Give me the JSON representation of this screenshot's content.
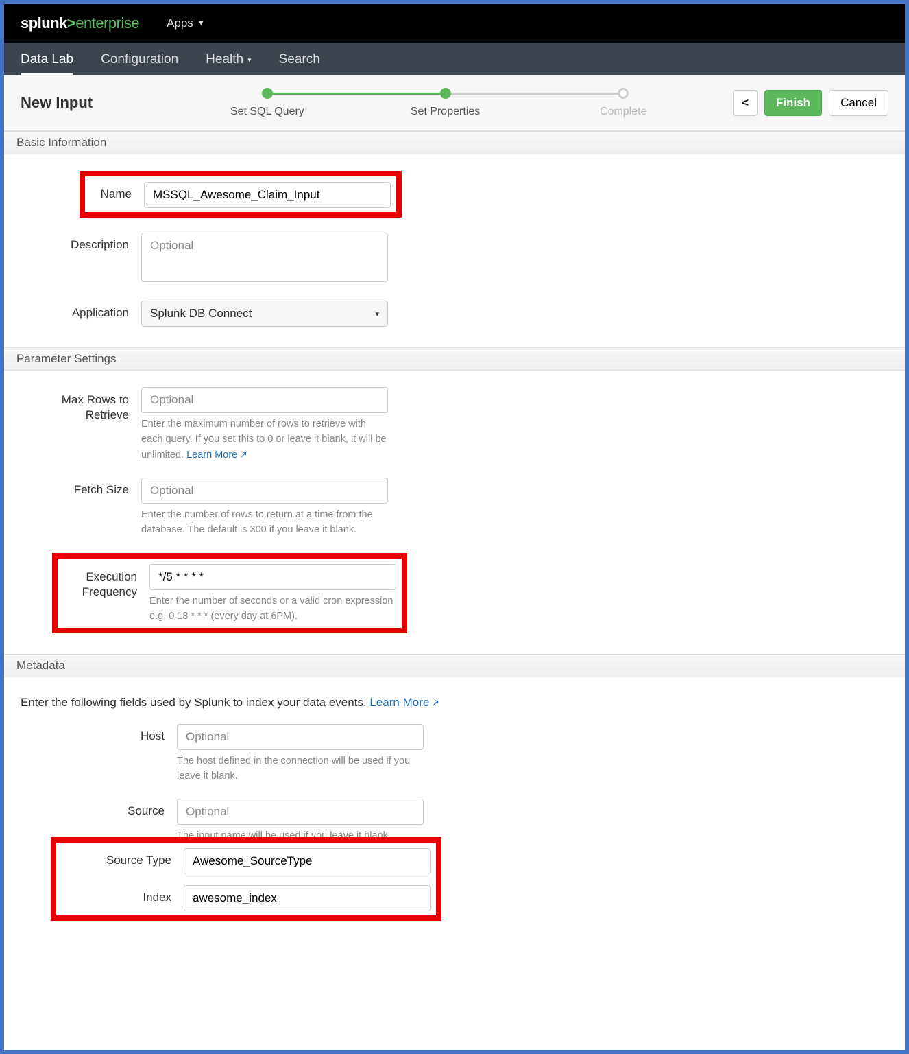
{
  "brand": {
    "s": "splunk",
    "gt": ">",
    "ent": "enterprise"
  },
  "topnav": {
    "apps": "Apps"
  },
  "tabs": {
    "datalab": "Data Lab",
    "config": "Configuration",
    "health": "Health",
    "search": "Search"
  },
  "wizard": {
    "title": "New Input",
    "step1": "Set SQL Query",
    "step2": "Set Properties",
    "step3": "Complete",
    "back": "<",
    "finish": "Finish",
    "cancel": "Cancel"
  },
  "sections": {
    "basic": "Basic Information",
    "param": "Parameter Settings",
    "meta": "Metadata"
  },
  "basic": {
    "name_label": "Name",
    "name_value": "MSSQL_Awesome_Claim_Input",
    "desc_label": "Description",
    "desc_placeholder": "Optional",
    "app_label": "Application",
    "app_value": "Splunk DB Connect"
  },
  "param": {
    "maxrows_label": "Max Rows to Retrieve",
    "maxrows_placeholder": "Optional",
    "maxrows_help": "Enter the maximum number of rows to retrieve with each query. If you set this to 0 or leave it blank, it will be unlimited. ",
    "fetch_label": "Fetch Size",
    "fetch_placeholder": "Optional",
    "fetch_help": "Enter the number of rows to return at a time from the database. The default is 300 if you leave it blank.",
    "exec_label": "Execution Frequency",
    "exec_value": "*/5 * * * *",
    "exec_help": "Enter the number of seconds or a valid cron expression e.g. 0 18 * * * (every day at 6PM).",
    "learn_more": "Learn More"
  },
  "meta": {
    "intro1": "Enter the following fields used by Splunk to index your data events. ",
    "learn_more": "Learn More",
    "host_label": "Host",
    "host_placeholder": "Optional",
    "host_help": "The host defined in the connection will be used if you leave it blank.",
    "source_label": "Source",
    "source_placeholder": "Optional",
    "source_help": "The input name will be used if you leave it blank.",
    "stype_label": "Source Type",
    "stype_value": "Awesome_SourceType",
    "index_label": "Index",
    "index_value": "awesome_index"
  }
}
